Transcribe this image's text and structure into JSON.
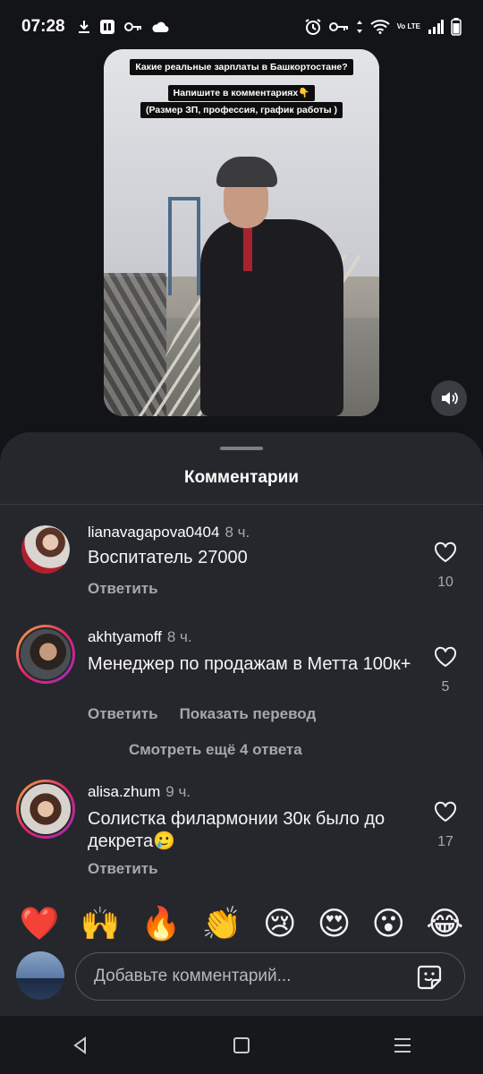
{
  "status_bar": {
    "time": "07:28",
    "left_icons": [
      "download-icon",
      "app-icon",
      "key-icon",
      "cloud-icon"
    ],
    "right_icons": [
      "alarm-icon",
      "vpn-key-icon",
      "data-arrows-icon",
      "wifi-icon",
      "volte-icon",
      "signal-icon",
      "battery-icon"
    ],
    "volte_label": "Vo LTE"
  },
  "video": {
    "caption_title": "Какие реальные  зарплаты в Башкортостане?",
    "caption_line1": "Напишите  в комментариях👇",
    "caption_line2": "(Размер ЗП, профессия, график работы )"
  },
  "sheet": {
    "title": "Комментарии",
    "reply_label": "Ответить",
    "translate_label": "Показать перевод",
    "more_replies": "Смотреть ещё 4 ответа"
  },
  "comments": [
    {
      "username": "lianavagapova0404",
      "time": "8 ч.",
      "text": "Воспитатель 27000",
      "likes": "10"
    },
    {
      "username": "akhtyamoff",
      "time": "8 ч.",
      "text": "Менеджер по продажам в Метта 100к+",
      "likes": "5"
    },
    {
      "username": "alisa.zhum",
      "time": "9 ч.",
      "text": "Солистка филармонии 30к было до декрета🥲",
      "likes": "17"
    }
  ],
  "emojis": [
    "❤️",
    "🙌",
    "🔥",
    "👏",
    "😢",
    "😍",
    "😮",
    "😂"
  ],
  "input": {
    "placeholder": "Добавьте комментарий..."
  },
  "colors": {
    "background": "#121418",
    "sheet": "#25272c",
    "secondary_text": "#a6a8ad",
    "story_ring_start": "#f8b13c",
    "story_ring_end": "#a32ec5"
  }
}
